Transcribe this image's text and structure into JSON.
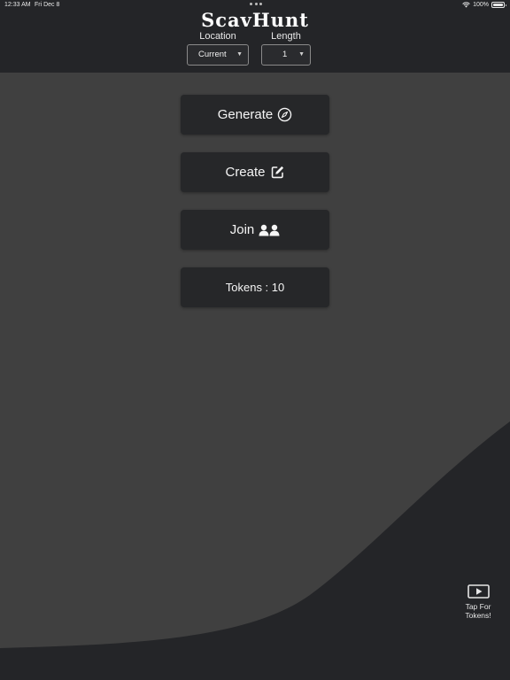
{
  "status_bar": {
    "time": "12:33 AM",
    "date": "Fri Dec 8",
    "battery": "100%",
    "icons": [
      "wifi-icon",
      "battery-icon"
    ]
  },
  "header": {
    "title": "ScavHunt",
    "location": {
      "label": "Location",
      "value": "Current"
    },
    "length": {
      "label": "Length",
      "value": "1"
    }
  },
  "menu": {
    "generate": {
      "label": "Generate",
      "icon": "compass-icon"
    },
    "create": {
      "label": "Create",
      "icon": "edit-icon"
    },
    "join": {
      "label": "Join",
      "icon": "users-icon"
    },
    "tokens": {
      "label": "Tokens : 10"
    }
  },
  "tap_tokens": {
    "line1": "Tap For",
    "line2": "Tokens!",
    "icon": "play-icon"
  },
  "colors": {
    "background": "#242528",
    "curve_fill": "#404040",
    "button_bg": "#262729",
    "text": "#f5f5f5"
  }
}
